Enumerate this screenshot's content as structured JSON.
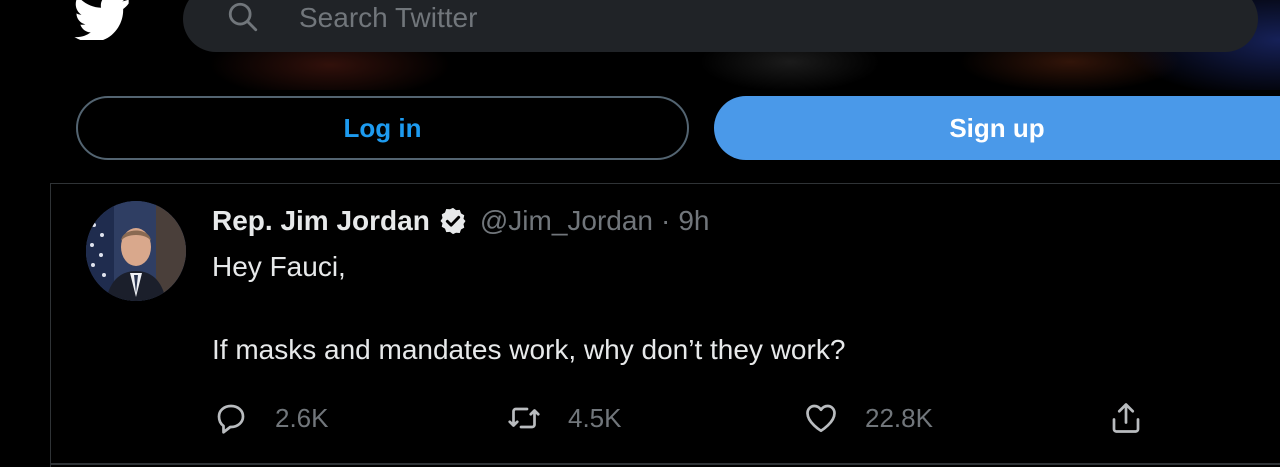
{
  "search": {
    "placeholder": "Search Twitter"
  },
  "auth": {
    "login_label": "Log in",
    "signup_label": "Sign up"
  },
  "tweet": {
    "display_name": "Rep. Jim Jordan",
    "handle": "@Jim_Jordan",
    "separator": "·",
    "time": "9h",
    "text_line_1": "Hey Fauci,",
    "text_line_2": "If masks and mandates work, why don’t they work?",
    "stats": {
      "replies": "2.6K",
      "retweets": "4.5K",
      "likes": "22.8K"
    }
  },
  "icons": {
    "logo": "twitter-bird-icon",
    "search": "search-icon",
    "verified": "verified-badge-icon",
    "reply": "reply-icon",
    "retweet": "retweet-icon",
    "like": "heart-icon",
    "share": "share-icon"
  },
  "colors": {
    "accent": "#1d9bf0",
    "signup_bg": "#4a99e9",
    "muted": "#71767b",
    "text": "#e7e9ea",
    "background": "#000000"
  }
}
